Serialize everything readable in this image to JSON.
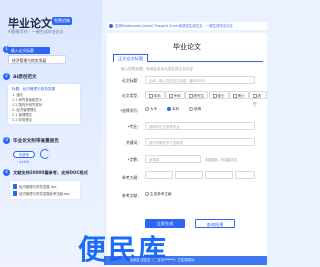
{
  "brand": {
    "title": "毕业论文",
    "badge": "免费初稿",
    "subtitle": "AI智能写作 · 一键生成毕业论文"
  },
  "steps": [
    {
      "num": "1",
      "label": "输入论文标题"
    },
    {
      "num": "2",
      "label": "AI原创范文"
    },
    {
      "num": "3",
      "label": "毕业论文附带查重报告"
    },
    {
      "num": "4",
      "label": "文献支持20000篇参考，支持DOC格式"
    }
  ],
  "left_input": {
    "tag": "输入论文标题",
    "value": "经济管理与财务发展"
  },
  "outline_card": {
    "head": "标题：经济管理与财务发展",
    "lines": [
      "1. 绪论",
      "  1.1 研究背景和意义",
      "  1.2 国内外研究现状",
      "2. 经济管理理论",
      "  2.1 管理理论",
      "  2.2 财务理论"
    ]
  },
  "check_pill": "查重率<10%",
  "doc_card": {
    "lines": [
      "经济管理与财务发展.doc",
      "经济管理与财务发展参考文献.doc"
    ]
  },
  "banner": "支持Multimodal-Global Thought Chain多语言生成论文，一键生成毕业论文",
  "panel": {
    "title": "毕业论文",
    "tab": "正文论文标题",
    "tip": "输入您的标题，系统会自动为您生成论文内容",
    "rows": {
      "title_label": "论文标题：",
      "title_placeholder": "必填，输入您的论文标题（最多50字）",
      "type_label": "论文类型：",
      "types": [
        "本科",
        "专科",
        "研究生",
        "硕士",
        "博士",
        "其它"
      ],
      "edu_label": "*选择学历：",
      "edu_options": [
        "大专",
        "本科",
        "硕博"
      ],
      "major_label": "*专业：",
      "major_placeholder": "请填写论文所属专业",
      "keyword_label": "关键词：",
      "keyword_placeholder": "用分号隔开多个关键词",
      "wordcount_label": "*字数：",
      "wordcount_placeholder": "请选择",
      "wordcount_note": "字数越多，内容越丰富",
      "outline_label": "参考大纲：",
      "outline_placeholder": "",
      "extra_label": "参考文献：",
      "extra_checkbox": "生成参考文献"
    },
    "submit": "立即生成",
    "query": "查询结果"
  },
  "watermark": "便民库",
  "marquee": "最新生成论文（工业与******）已生成成功"
}
